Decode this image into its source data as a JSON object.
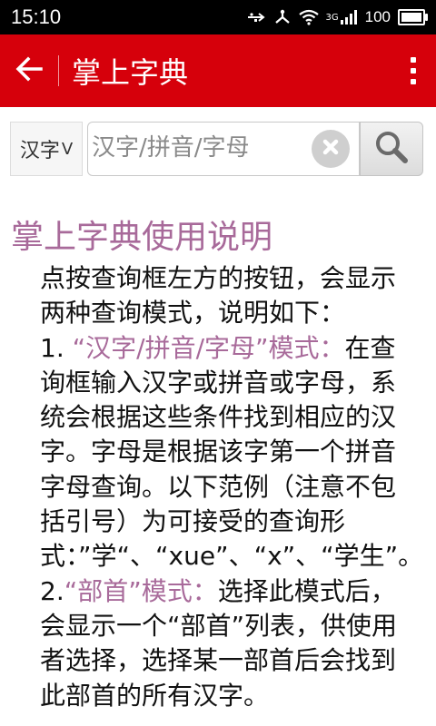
{
  "status_bar": {
    "time": "15:10",
    "network": "3G",
    "battery_text": "100"
  },
  "app_bar": {
    "title": "掌上字典",
    "icons": {
      "back": "arrow-left-icon",
      "overflow": "more-vert-icon"
    }
  },
  "search": {
    "mode_label": "汉字",
    "mode_chevron": "V",
    "placeholder": "汉字/拼音/字母",
    "value": ""
  },
  "content": {
    "heading": "掌上字典使用说明",
    "lines": [
      {
        "parts": [
          {
            "text": "点按查询框左方的按钮，会显示",
            "hl": false
          }
        ]
      },
      {
        "parts": [
          {
            "text": "两种查询模式，说明如下：",
            "hl": false
          }
        ]
      },
      {
        "parts": [
          {
            "text": "1. ",
            "hl": false
          },
          {
            "text": "“汉字/拼音/字母”模式：",
            "hl": true
          },
          {
            "text": "在查",
            "hl": false
          }
        ]
      },
      {
        "parts": [
          {
            "text": "询框输入汉字或拼音或字母，系",
            "hl": false
          }
        ]
      },
      {
        "parts": [
          {
            "text": "统会根据这些条件找到相应的汉",
            "hl": false
          }
        ]
      },
      {
        "parts": [
          {
            "text": "字。字母是根据该字第一个拼音",
            "hl": false
          }
        ]
      },
      {
        "parts": [
          {
            "text": "字母查询。以下范例（注意不包",
            "hl": false
          }
        ]
      },
      {
        "parts": [
          {
            "text": "括引号）为可接受的查询形",
            "hl": false
          }
        ]
      },
      {
        "parts": [
          {
            "text": "式：”学“、“xue”、“x”、“学生”。",
            "hl": false
          }
        ]
      },
      {
        "parts": [
          {
            "text": "2.",
            "hl": false
          },
          {
            "text": "“部首”模式：",
            "hl": true
          },
          {
            "text": "选择此模式后，",
            "hl": false
          }
        ]
      },
      {
        "parts": [
          {
            "text": "会显示一个“部首”列表，供使用",
            "hl": false
          }
        ]
      },
      {
        "parts": [
          {
            "text": "者选择，选择某一部首后会找到",
            "hl": false
          }
        ]
      },
      {
        "parts": [
          {
            "text": "此部首的所有汉字。",
            "hl": false
          }
        ]
      }
    ]
  },
  "colors": {
    "app_bar": "#d6000b",
    "heading": "#a86a9a",
    "highlight": "#a86a9a"
  }
}
